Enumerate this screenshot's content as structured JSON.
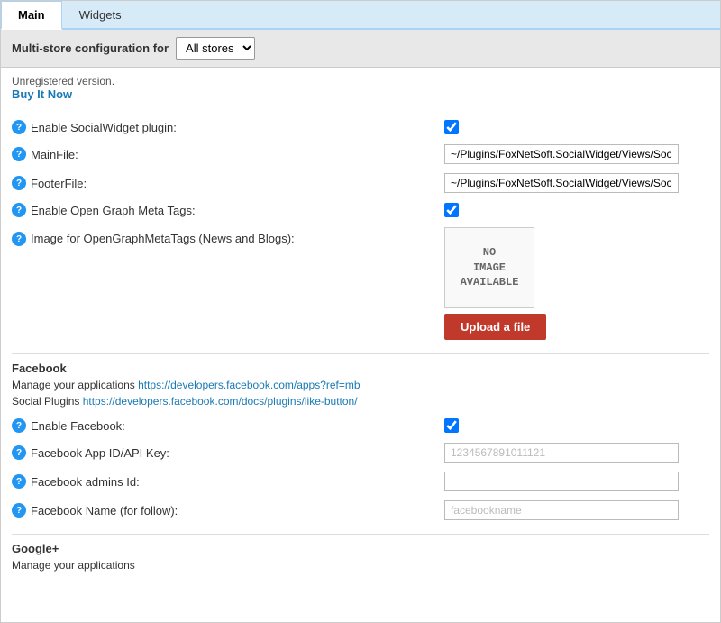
{
  "tabs": [
    {
      "label": "Main",
      "active": true
    },
    {
      "label": "Widgets",
      "active": false
    }
  ],
  "multistore": {
    "label": "Multi-store configuration for",
    "options": [
      "All stores"
    ],
    "selected": "All stores"
  },
  "version": {
    "text": "Unregistered version.",
    "buy_link": "Buy It Now"
  },
  "fields": {
    "enable_social_widget": {
      "help": "?",
      "label": "Enable SocialWidget plugin:",
      "checked": true
    },
    "main_file": {
      "help": "?",
      "label": "MainFile:",
      "value": "~/Plugins/FoxNetSoft.SocialWidget/Views/Soci"
    },
    "footer_file": {
      "help": "?",
      "label": "FooterFile:",
      "value": "~/Plugins/FoxNetSoft.SocialWidget/Views/Soci"
    },
    "enable_open_graph": {
      "help": "?",
      "label": "Enable Open Graph Meta Tags:",
      "checked": true
    },
    "image_for_open_graph": {
      "help": "?",
      "label": "Image for OpenGraphMetaTags (News and Blogs):",
      "placeholder_text": "NO\nIMAGE\nAVAILABLE",
      "upload_label": "Upload a file"
    }
  },
  "facebook": {
    "header": "Facebook",
    "desc_prefix": "Manage your applications ",
    "desc_link1": "https://developers.facebook.com/apps?ref=mb",
    "desc_line2_prefix": "Social Plugins ",
    "desc_link2": "https://developers.facebook.com/docs/plugins/like-button/",
    "enable": {
      "help": "?",
      "label": "Enable Facebook:",
      "checked": true
    },
    "app_id": {
      "help": "?",
      "label": "Facebook App ID/API Key:",
      "value": "1234567891011121"
    },
    "admins_id": {
      "help": "?",
      "label": "Facebook admins Id:",
      "value": ""
    },
    "name": {
      "help": "?",
      "label": "Facebook Name (for follow):",
      "value": "facebookname"
    }
  },
  "googleplus": {
    "header": "Google+",
    "desc": "Manage your applications"
  }
}
